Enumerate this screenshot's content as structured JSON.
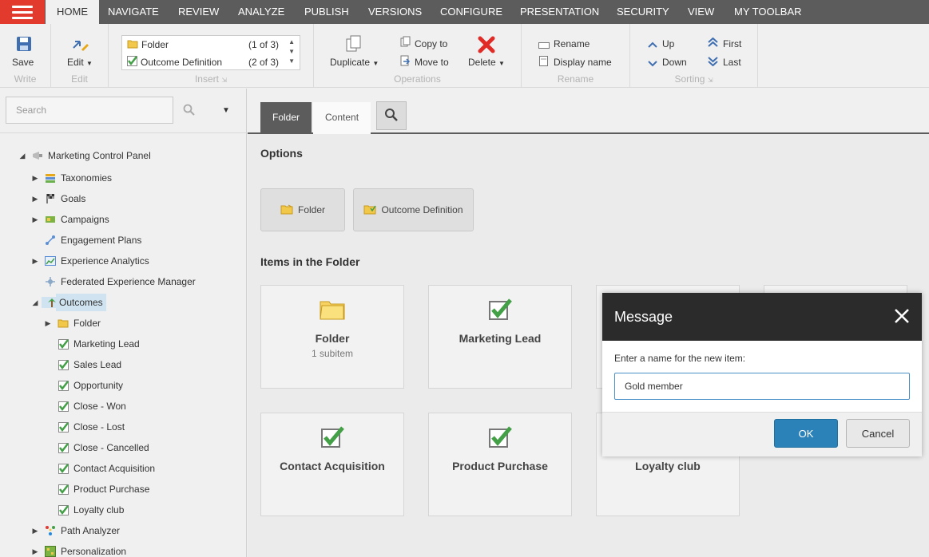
{
  "menu": {
    "tabs": [
      "HOME",
      "NAVIGATE",
      "REVIEW",
      "ANALYZE",
      "PUBLISH",
      "VERSIONS",
      "CONFIGURE",
      "PRESENTATION",
      "SECURITY",
      "VIEW",
      "MY TOOLBAR"
    ],
    "active": "HOME"
  },
  "ribbon": {
    "write": {
      "save": "Save",
      "group": "Write"
    },
    "edit": {
      "edit": "Edit",
      "group": "Edit"
    },
    "insert": {
      "items": [
        {
          "label": "Folder",
          "count": "(1 of 3)"
        },
        {
          "label": "Outcome Definition",
          "count": "(2 of 3)"
        }
      ],
      "group": "Insert"
    },
    "operations": {
      "duplicate": "Duplicate",
      "copy_to": "Copy to",
      "move_to": "Move to",
      "delete": "Delete",
      "group": "Operations"
    },
    "rename": {
      "rename": "Rename",
      "display_name": "Display name",
      "group": "Rename"
    },
    "sorting": {
      "up": "Up",
      "down": "Down",
      "first": "First",
      "last": "Last",
      "group": "Sorting"
    }
  },
  "search": {
    "placeholder": "Search"
  },
  "tree": {
    "root": "Marketing Control Panel",
    "items": [
      {
        "label": "Taxonomies"
      },
      {
        "label": "Goals"
      },
      {
        "label": "Campaigns"
      },
      {
        "label": "Engagement Plans"
      },
      {
        "label": "Experience Analytics"
      },
      {
        "label": "Federated Experience Manager"
      },
      {
        "label": "Outcomes"
      }
    ],
    "outcomes_children": [
      {
        "label": "Folder"
      },
      {
        "label": "Marketing Lead"
      },
      {
        "label": "Sales Lead"
      },
      {
        "label": "Opportunity"
      },
      {
        "label": "Close - Won"
      },
      {
        "label": "Close - Lost"
      },
      {
        "label": "Close - Cancelled"
      },
      {
        "label": "Contact Acquisition"
      },
      {
        "label": "Product Purchase"
      },
      {
        "label": "Loyalty club"
      }
    ],
    "after": [
      {
        "label": "Path Analyzer"
      },
      {
        "label": "Personalization"
      }
    ]
  },
  "content": {
    "tabs": {
      "folder": "Folder",
      "content": "Content"
    },
    "options_title": "Options",
    "options": {
      "folder": "Folder",
      "outcome_definition": "Outcome Definition"
    },
    "items_title": "Items in the Folder",
    "tiles": [
      {
        "name": "Folder",
        "sub": "1 subitem"
      },
      {
        "name": "Marketing Lead"
      },
      {
        "name": "Contact Acquisition"
      },
      {
        "name": "Product Purchase"
      },
      {
        "name": "Loyalty club"
      }
    ]
  },
  "dialog": {
    "title": "Message",
    "prompt": "Enter a name for the new item:",
    "value": "Gold member",
    "ok": "OK",
    "cancel": "Cancel"
  },
  "colors": {
    "menu_bg": "#5c5c5c",
    "hamburger": "#e23b2e",
    "dialog_head": "#2b2b2b",
    "ok_button": "#2a82b8",
    "check_green": "#43a047",
    "selected_row": "#cfe3f0"
  }
}
